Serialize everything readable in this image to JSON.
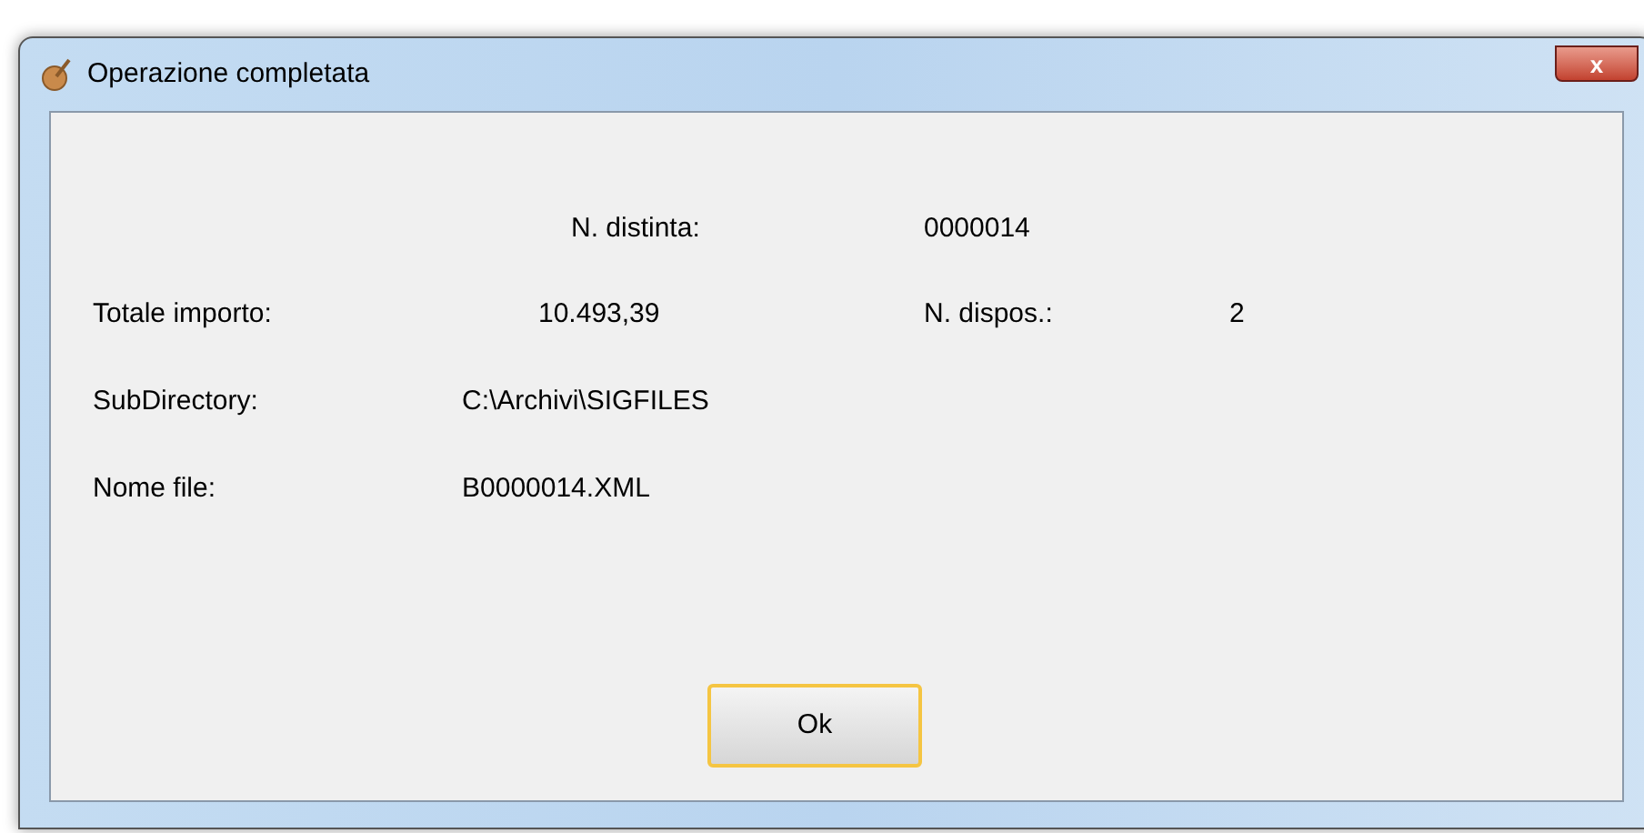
{
  "window": {
    "title": "Operazione completata",
    "close": "x"
  },
  "distinta": {
    "label": "N. distinta:",
    "value": "0000014"
  },
  "totale": {
    "label": "Totale importo:",
    "value": "10.493,39"
  },
  "dispos": {
    "label": "N. dispos.:",
    "value": "2"
  },
  "subdirectory": {
    "label": "SubDirectory:",
    "value": "C:\\Archivi\\SIGFILES"
  },
  "nome_file": {
    "label": "Nome file:",
    "value": "B0000014.XML"
  },
  "button": {
    "label": "Ok",
    "focused": true
  }
}
